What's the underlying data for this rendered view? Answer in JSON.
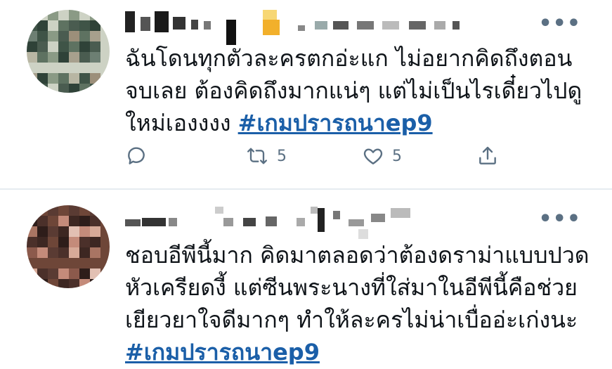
{
  "tweets": [
    {
      "text_before": "ฉันโดนทุกตัวละครตกอ่ะแก ไม่อยากคิดถึงตอนจบเลย ต้องคิดถึงมากแน่ๆ แต่ไม่เป็นไรเดี๋ยวไปดูใหม่เองงงง",
      "hashtag": "#เกมปรารถนาep9",
      "retweets": "5",
      "likes": "5",
      "icons": [
        "reply-icon",
        "retweet-icon",
        "like-icon",
        "share-icon",
        "more-icon"
      ],
      "more_label": "•••"
    },
    {
      "text_before": "ชอบอีพีนี้มาก คิดมาตลอดว่าต้องดราม่าแบบปวดหัวเครียดงี้ แต่ซีนพระนางที่ใส่มาในอีพีนี้คือช่วยเยียวยาใจดีมากๆ ทำให้ละครไม่น่าเบื่ออ่ะเก่งนะ",
      "hashtag": "#เกมปรารถนาep9",
      "more_label": "•••"
    }
  ],
  "colors": {
    "hashtag": "#1b5fa8",
    "muted": "#5b7083",
    "divider": "#e6ecf0"
  }
}
